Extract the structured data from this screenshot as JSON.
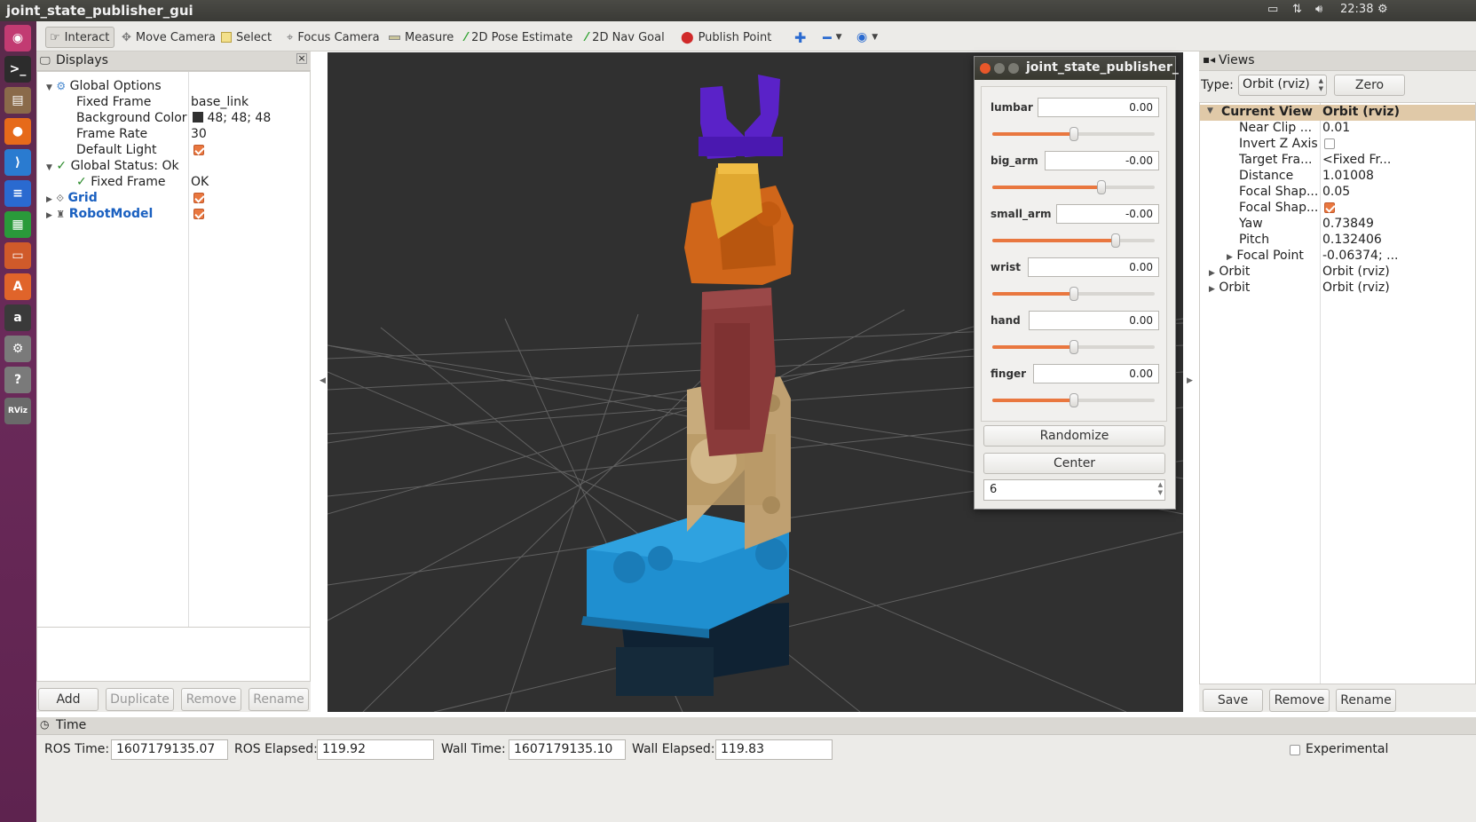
{
  "window": {
    "title": "joint_state_publisher_gui"
  },
  "system": {
    "time": "22:38"
  },
  "launcher": {
    "items": [
      {
        "name": "ubuntu-dash-icon",
        "glyph": "◉",
        "color": "#c23b72"
      },
      {
        "name": "terminal-icon",
        "glyph": ">_",
        "color": "#2c2c2c"
      },
      {
        "name": "files-icon",
        "glyph": "▤",
        "color": "#8a6a4a"
      },
      {
        "name": "firefox-icon",
        "glyph": "●",
        "color": "#e66a1a"
      },
      {
        "name": "vscode-icon",
        "glyph": "⟩",
        "color": "#2a7bd0"
      },
      {
        "name": "writer-icon",
        "glyph": "≡",
        "color": "#2a6ad0"
      },
      {
        "name": "calc-icon",
        "glyph": "▦",
        "color": "#2a9a3a"
      },
      {
        "name": "impress-icon",
        "glyph": "▭",
        "color": "#d05a2a"
      },
      {
        "name": "software-center-icon",
        "glyph": "A",
        "color": "#e0642a"
      },
      {
        "name": "amazon-icon",
        "glyph": "a",
        "color": "#3a3a3a"
      },
      {
        "name": "settings-icon",
        "glyph": "⚙",
        "color": "#7a7a7a"
      },
      {
        "name": "help-icon",
        "glyph": "?",
        "color": "#7a7a7a"
      },
      {
        "name": "rviz-icon",
        "glyph": "RViz",
        "color": "#6a6a6a"
      }
    ]
  },
  "toolbar": {
    "interact": "Interact",
    "move_camera": "Move Camera",
    "select": "Select",
    "focus_camera": "Focus Camera",
    "measure": "Measure",
    "pose_estimate": "2D Pose Estimate",
    "nav_goal": "2D Nav Goal",
    "publish_point": "Publish Point"
  },
  "displays": {
    "title": "Displays",
    "rows": {
      "global_options": "Global Options",
      "fixed_frame_label": "Fixed Frame",
      "fixed_frame_value": "base_link",
      "bg_color_label": "Background Color",
      "bg_color_value": "48; 48; 48",
      "frame_rate_label": "Frame Rate",
      "frame_rate_value": "30",
      "default_light_label": "Default Light",
      "global_status": "Global Status: Ok",
      "fixed_frame_status_label": "Fixed Frame",
      "fixed_frame_status_value": "OK",
      "grid": "Grid",
      "robot_model": "RobotModel"
    },
    "buttons": {
      "add": "Add",
      "duplicate": "Duplicate",
      "remove": "Remove",
      "rename": "Rename"
    }
  },
  "jsp": {
    "title": "joint_state_publisher_",
    "joints": [
      {
        "name": "lumbar",
        "value": "0.00",
        "level": 0.5
      },
      {
        "name": "big_arm",
        "value": "-0.00",
        "level": 0.67
      },
      {
        "name": "small_arm",
        "value": "-0.00",
        "level": 0.76
      },
      {
        "name": "wrist",
        "value": "0.00",
        "level": 0.5
      },
      {
        "name": "hand",
        "value": "0.00",
        "level": 0.5
      },
      {
        "name": "finger",
        "value": "0.00",
        "level": 0.5
      }
    ],
    "randomize": "Randomize",
    "center": "Center",
    "spin_value": "6"
  },
  "views": {
    "title": "Views",
    "type_label": "Type:",
    "type_value": "Orbit (rviz)",
    "zero": "Zero",
    "current_view": "Current View",
    "current_view_value": "Orbit (rviz)",
    "props": [
      {
        "label": "Near Clip ...",
        "value": "0.01"
      },
      {
        "label": "Invert Z Axis",
        "value": ""
      },
      {
        "label": "Target Fra...",
        "value": "<Fixed Fr..."
      },
      {
        "label": "Distance",
        "value": "1.01008"
      },
      {
        "label": "Focal Shap...",
        "value": "0.05"
      },
      {
        "label": "Focal Shap...",
        "value": ""
      },
      {
        "label": "Yaw",
        "value": "0.73849"
      },
      {
        "label": "Pitch",
        "value": "0.132406"
      },
      {
        "label": "Focal Point",
        "value": "-0.06374; ..."
      }
    ],
    "saved": [
      {
        "label": "Orbit",
        "value": "Orbit (rviz)"
      },
      {
        "label": "Orbit",
        "value": "Orbit (rviz)"
      }
    ],
    "buttons": {
      "save": "Save",
      "remove": "Remove",
      "rename": "Rename"
    }
  },
  "time": {
    "title": "Time",
    "ros_time_label": "ROS Time:",
    "ros_time": "1607179135.07",
    "ros_elapsed_label": "ROS Elapsed:",
    "ros_elapsed": "119.92",
    "wall_time_label": "Wall Time:",
    "wall_time": "1607179135.10",
    "wall_elapsed_label": "Wall Elapsed:",
    "wall_elapsed": "119.83",
    "experimental": "Experimental"
  },
  "colors": {
    "background": "#303030",
    "base": "#1f8fd0",
    "tan": "#c8ab7c",
    "maroon": "#8a3a3a",
    "orange": "#d0661a",
    "gold": "#e0a830",
    "purple": "#5a22c8"
  }
}
